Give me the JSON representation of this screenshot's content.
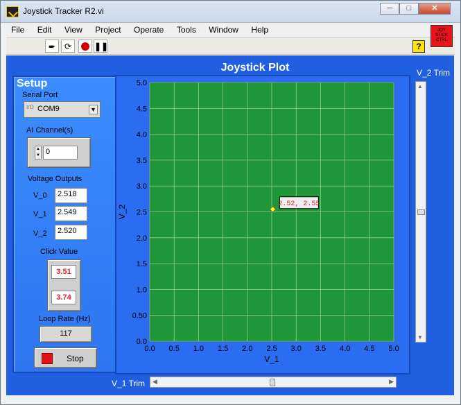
{
  "window": {
    "title": "Joystick Tracker R2.vi",
    "controls": {
      "minimize": "─",
      "maximize": "□",
      "close": "✕"
    }
  },
  "menu": [
    "File",
    "Edit",
    "View",
    "Project",
    "Operate",
    "Tools",
    "Window",
    "Help"
  ],
  "toolbar": {
    "run_icon": "run-arrow-icon",
    "run_continuous_icon": "run-continuously-icon",
    "abort_icon": "abort-icon",
    "pause_icon": "pause-icon",
    "help_label": "?",
    "vi_icon_label": "JOY STICK CTRL"
  },
  "setup": {
    "title": "Setup",
    "serial_port": {
      "label": "Serial Port",
      "value": "COM9",
      "prefix": "I/O"
    },
    "ai_channel": {
      "label": "AI Channel(s)",
      "value": "0"
    },
    "voltage_outputs": {
      "label": "Voltage Outputs",
      "items": [
        {
          "name": "V_0",
          "value": "2.518"
        },
        {
          "name": "V_1",
          "value": "2.549"
        },
        {
          "name": "V_2",
          "value": "2.520"
        }
      ]
    },
    "click_value": {
      "label": "Click Value",
      "values": [
        "3.51",
        "3.74"
      ]
    },
    "loop_rate": {
      "label": "Loop Rate (Hz)",
      "value": "117"
    },
    "stop_label": "Stop"
  },
  "plot": {
    "title": "Joystick Plot",
    "v2_trim_label": "V_2 Trim",
    "v1_trim_label": "V_1 Trim",
    "v1_trim_value": 0.5,
    "v2_trim_value": 0.5
  },
  "chart_data": {
    "type": "scatter",
    "title": "Joystick Plot",
    "xlabel": "V_1",
    "ylabel": "V_2",
    "xlim": [
      0.0,
      5.0
    ],
    "ylim": [
      0.0,
      5.0
    ],
    "xticks": [
      "0.0",
      "0.5",
      "1.0",
      "1.5",
      "2.0",
      "2.5",
      "3.0",
      "3.5",
      "4.0",
      "4.5",
      "5.0"
    ],
    "yticks": [
      "0.0",
      "0.50",
      "1.0",
      "1.5",
      "2.0",
      "2.5",
      "3.0",
      "3.5",
      "4.0",
      "4.5",
      "5.0"
    ],
    "grid": true,
    "points": [
      {
        "x": 2.52,
        "y": 2.55,
        "label": "2.52, 2.55"
      }
    ],
    "colors": {
      "background": "#1f9637",
      "grid": "#8fcf8f",
      "point": "#ffff00",
      "label_text": "#e0202b"
    }
  }
}
